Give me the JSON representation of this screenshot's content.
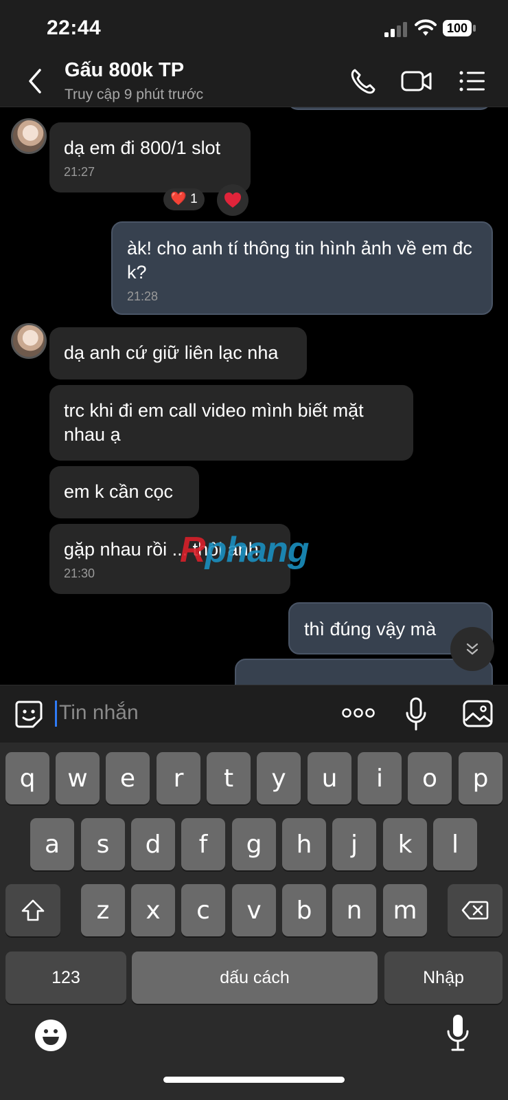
{
  "status_bar": {
    "time": "22:44",
    "battery": "100"
  },
  "header": {
    "title": "Gấu 800k TP",
    "subtitle": "Truy cập 9 phút trước"
  },
  "messages": [
    {
      "direction": "in",
      "text": "dạ em đi 800/1 slot",
      "time": "21:27",
      "reaction_count": "1"
    },
    {
      "direction": "out",
      "text": "àk! cho anh tí thông tin hình ảnh về em đc k?",
      "time": "21:28"
    },
    {
      "direction": "in",
      "text": "dạ anh cứ giữ liên lạc nha"
    },
    {
      "direction": "in",
      "text": "trc khi đi em call video mình biết mặt nhau ạ"
    },
    {
      "direction": "in",
      "text": "em k cần cọc"
    },
    {
      "direction": "in",
      "text": "gặp nhau rồi ... thôi anh",
      "time": "21:30"
    },
    {
      "direction": "out",
      "text": "thì đúng vậy mà"
    }
  ],
  "watermark": {
    "part1": "R",
    "part2": "phang"
  },
  "input": {
    "placeholder": "Tin nhắn"
  },
  "keyboard": {
    "row1": [
      "q",
      "w",
      "e",
      "r",
      "t",
      "y",
      "u",
      "i",
      "o",
      "p"
    ],
    "row2": [
      "a",
      "s",
      "d",
      "f",
      "g",
      "h",
      "j",
      "k",
      "l"
    ],
    "row3": [
      "z",
      "x",
      "c",
      "v",
      "b",
      "n",
      "m"
    ],
    "numbers_label": "123",
    "space_label": "dấu cách",
    "return_label": "Nhập"
  },
  "colors": {
    "outgoing_bubble": "#37414f",
    "incoming_bubble": "#272727",
    "accent": "#2f7bf6",
    "heart": "#e0243a"
  }
}
